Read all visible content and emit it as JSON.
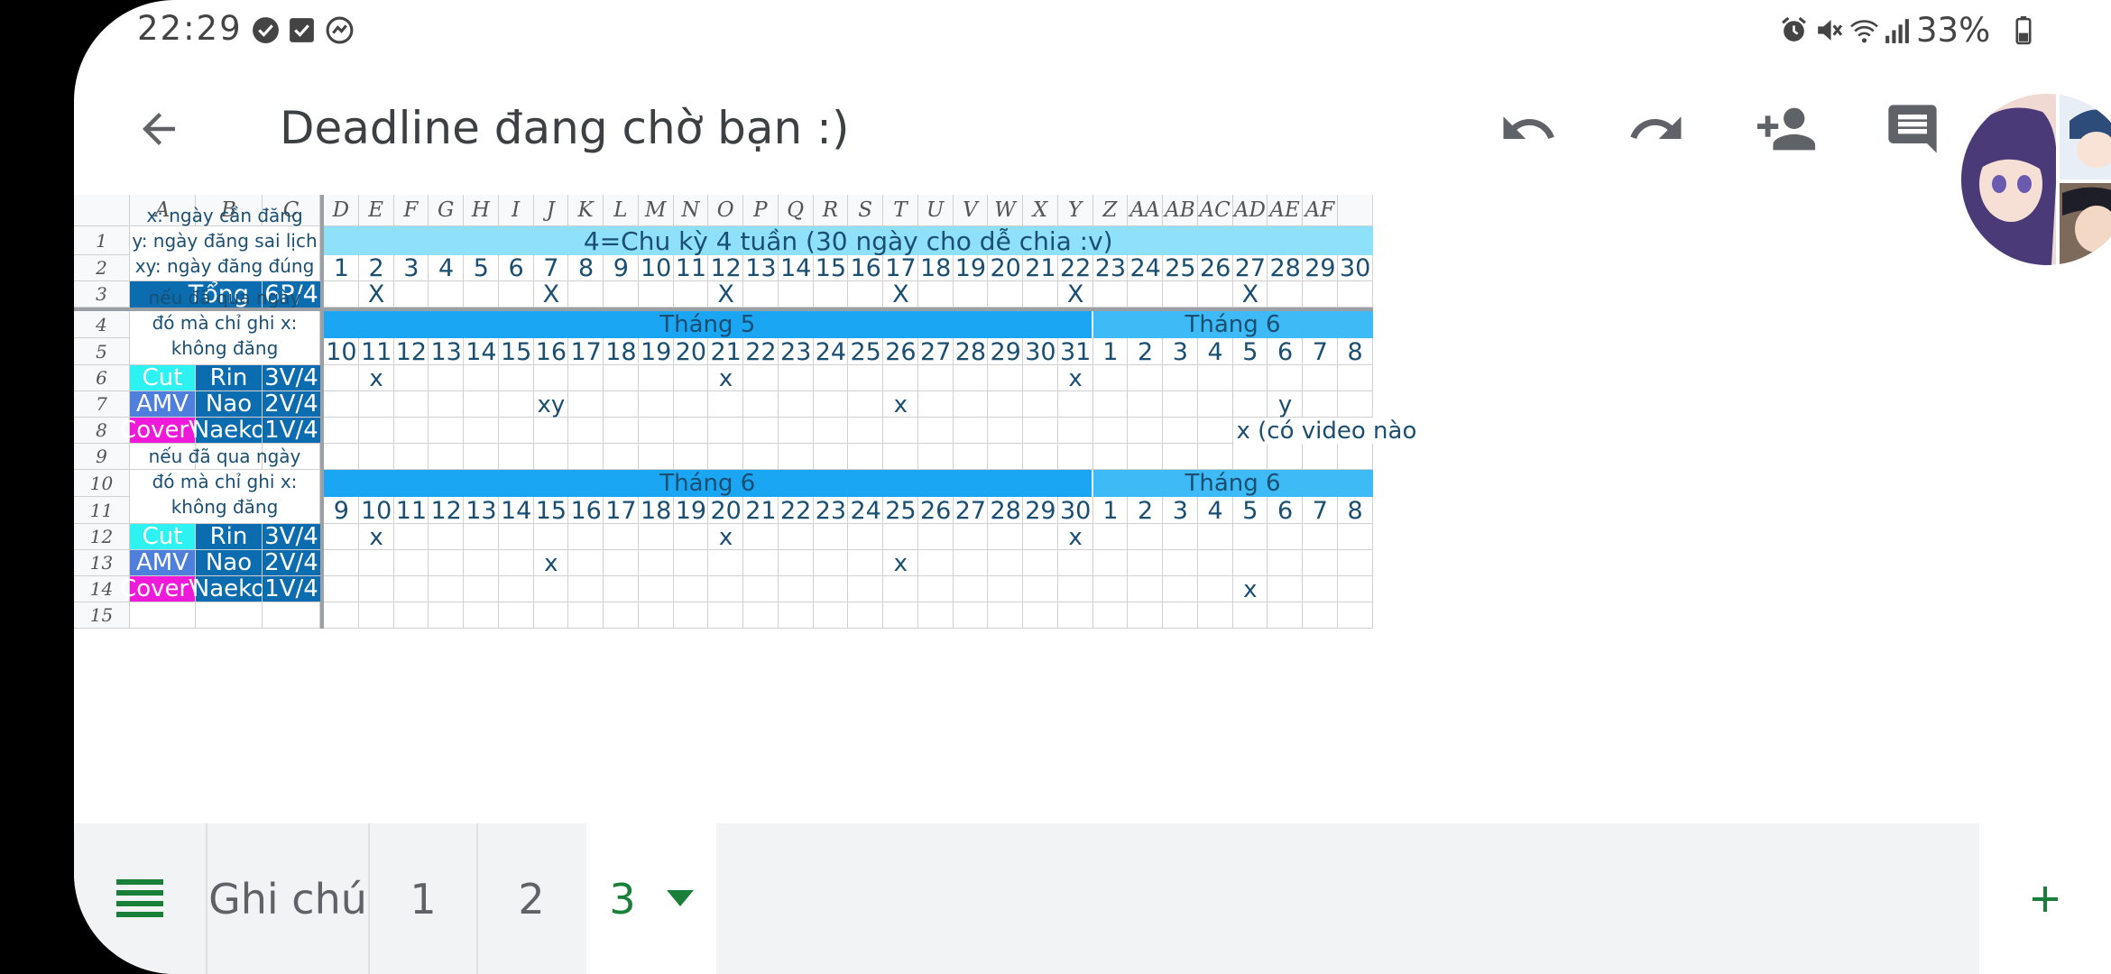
{
  "status_bar": {
    "time": "22:29",
    "battery": "33%"
  },
  "toolbar": {
    "title": "Deadline đang chờ bạn :)"
  },
  "columns": [
    "A",
    "B",
    "C",
    "D",
    "E",
    "F",
    "G",
    "H",
    "I",
    "J",
    "K",
    "L",
    "M",
    "N",
    "O",
    "P",
    "Q",
    "R",
    "S",
    "T",
    "U",
    "V",
    "W",
    "X",
    "Y",
    "Z",
    "AA",
    "AB",
    "AC",
    "AD",
    "AE",
    "AF"
  ],
  "rows": [
    "1",
    "2",
    "3",
    "4",
    "5",
    "6",
    "7",
    "8",
    "9",
    "10",
    "11",
    "12",
    "13",
    "14",
    "15"
  ],
  "legend": {
    "line1": "x: ngày cần đăng",
    "line2": "y: ngày đăng sai lịch",
    "line3": "xy: ngày đăng đúng lịch"
  },
  "totals": {
    "label": "Tổng",
    "value": "6P/4"
  },
  "cycle_header": "4=Chu kỳ 4 tuần (30 ngày cho dễ chia :v)",
  "cycle_days": [
    "1",
    "2",
    "3",
    "4",
    "5",
    "6",
    "7",
    "8",
    "9",
    "10",
    "11",
    "12",
    "13",
    "14",
    "15",
    "16",
    "17",
    "18",
    "19",
    "20",
    "21",
    "22",
    "23",
    "24",
    "25",
    "26",
    "27",
    "28",
    "29",
    "30"
  ],
  "total_marks": [
    "",
    "X",
    "",
    "",
    "",
    "",
    "X",
    "",
    "",
    "",
    "",
    "X",
    "",
    "",
    "",
    "",
    "X",
    "",
    "",
    "",
    "",
    "X",
    "",
    "",
    "",
    "",
    "X",
    "",
    "",
    ""
  ],
  "blocks": [
    {
      "note": "nếu đã qua ngày đó mà chỉ ghi x: không đăng",
      "month1": "Tháng 5",
      "month2": "Tháng 6",
      "days": [
        "10",
        "11",
        "12",
        "13",
        "14",
        "15",
        "16",
        "17",
        "18",
        "19",
        "20",
        "21",
        "22",
        "23",
        "24",
        "25",
        "26",
        "27",
        "28",
        "29",
        "30",
        "31",
        "1",
        "2",
        "3",
        "4",
        "5",
        "6",
        "7",
        "8"
      ],
      "rows": [
        {
          "type": "Cut",
          "person": "Rin",
          "quota": "3V/4",
          "marks": [
            "",
            "x",
            "",
            "",
            "",
            "",
            "",
            "",
            "",
            "",
            "",
            "x",
            "",
            "",
            "",
            "",
            "",
            "",
            "",
            "",
            "",
            "x",
            "",
            "",
            "",
            "",
            "",
            "",
            "",
            ""
          ]
        },
        {
          "type": "AMV",
          "person": "Nao",
          "quota": "2V/4",
          "marks": [
            "",
            "",
            "",
            "",
            "",
            "",
            "xy",
            "",
            "",
            "",
            "",
            "",
            "",
            "",
            "",
            "",
            "x",
            "",
            "",
            "",
            "",
            "",
            "",
            "",
            "",
            "",
            "",
            "y",
            "",
            ""
          ]
        },
        {
          "type": "CoverV",
          "person": "Naeko",
          "quota": "1V/4",
          "marks": [
            "",
            "",
            "",
            "",
            "",
            "",
            "",
            "",
            "",
            "",
            "",
            "",
            "",
            "",
            "",
            "",
            "",
            "",
            "",
            "",
            "",
            "",
            "",
            "",
            "",
            "",
            "x (có video nào",
            "",
            "",
            ""
          ]
        }
      ]
    },
    {
      "note": "nếu đã qua ngày đó mà chỉ ghi x: không đăng",
      "month1": "Tháng 6",
      "month2": "Tháng 6",
      "days": [
        "9",
        "10",
        "11",
        "12",
        "13",
        "14",
        "15",
        "16",
        "17",
        "18",
        "19",
        "20",
        "21",
        "22",
        "23",
        "24",
        "25",
        "26",
        "27",
        "28",
        "29",
        "30",
        "1",
        "2",
        "3",
        "4",
        "5",
        "6",
        "7",
        "8"
      ],
      "rows": [
        {
          "type": "Cut",
          "person": "Rin",
          "quota": "3V/4",
          "marks": [
            "",
            "x",
            "",
            "",
            "",
            "",
            "",
            "",
            "",
            "",
            "",
            "x",
            "",
            "",
            "",
            "",
            "",
            "",
            "",
            "",
            "",
            "x",
            "",
            "",
            "",
            "",
            "",
            "",
            "",
            ""
          ]
        },
        {
          "type": "AMV",
          "person": "Nao",
          "quota": "2V/4",
          "marks": [
            "",
            "",
            "",
            "",
            "",
            "",
            "x",
            "",
            "",
            "",
            "",
            "",
            "",
            "",
            "",
            "",
            "x",
            "",
            "",
            "",
            "",
            "",
            "",
            "",
            "",
            "",
            "",
            "",
            "",
            ""
          ]
        },
        {
          "type": "CoverV",
          "person": "Naeko",
          "quota": "1V/4",
          "marks": [
            "",
            "",
            "",
            "",
            "",
            "",
            "",
            "",
            "",
            "",
            "",
            "",
            "",
            "",
            "",
            "",
            "",
            "",
            "",
            "",
            "",
            "",
            "",
            "",
            "",
            "",
            "x",
            "",
            "",
            ""
          ]
        }
      ]
    }
  ],
  "type_colors": {
    "Cut": "#2ef2f2",
    "AMV": "#4f7fdc",
    "CoverV": "#ef1ad9"
  },
  "colors": {
    "header_blue": "#0b6db0",
    "cycle_band": "#8fe0fb",
    "month_primary": "#1ba6f3",
    "month_secondary": "#3ebaf7",
    "tab_active": "#188038"
  },
  "sheet_tabs": [
    {
      "label": "Ghi chú",
      "active": false
    },
    {
      "label": "1",
      "active": false
    },
    {
      "label": "2",
      "active": false
    },
    {
      "label": "3",
      "active": true
    }
  ]
}
